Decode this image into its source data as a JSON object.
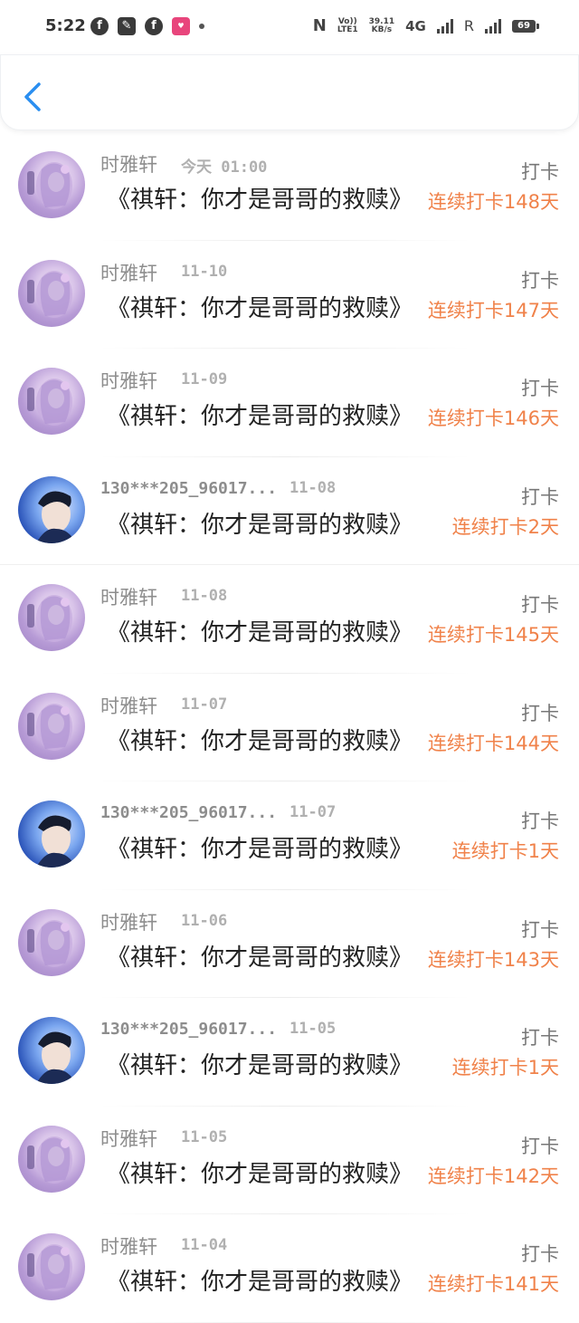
{
  "status_bar": {
    "time": "5:22",
    "net_speed_value": "39.11",
    "net_speed_unit": "KB/s",
    "volte_top": "Vo))",
    "volte_bottom": "LTE1",
    "network": "4G",
    "roaming": "R",
    "battery": "69"
  },
  "header": {
    "back_icon": "chevron-left-icon"
  },
  "entries": [
    {
      "user": "时雅轩",
      "date": "今天 01:00",
      "title": "《祺轩：你才是哥哥的救赎》",
      "action": "打卡",
      "streak": "连续打卡148天",
      "avatar": "girl"
    },
    {
      "user": "时雅轩",
      "date": "11-10",
      "title": "《祺轩：你才是哥哥的救赎》",
      "action": "打卡",
      "streak": "连续打卡147天",
      "avatar": "girl"
    },
    {
      "user": "时雅轩",
      "date": "11-09",
      "title": "《祺轩：你才是哥哥的救赎》",
      "action": "打卡",
      "streak": "连续打卡146天",
      "avatar": "girl"
    },
    {
      "user": "130***205_96017...",
      "date": "11-08",
      "title": "《祺轩：你才是哥哥的救赎》",
      "action": "打卡",
      "streak": "连续打卡2天",
      "avatar": "boy"
    },
    {
      "user": "时雅轩",
      "date": "11-08",
      "title": "《祺轩：你才是哥哥的救赎》",
      "action": "打卡",
      "streak": "连续打卡145天",
      "avatar": "girl"
    },
    {
      "user": "时雅轩",
      "date": "11-07",
      "title": "《祺轩：你才是哥哥的救赎》",
      "action": "打卡",
      "streak": "连续打卡144天",
      "avatar": "girl"
    },
    {
      "user": "130***205_96017...",
      "date": "11-07",
      "title": "《祺轩：你才是哥哥的救赎》",
      "action": "打卡",
      "streak": "连续打卡1天",
      "avatar": "boy"
    },
    {
      "user": "时雅轩",
      "date": "11-06",
      "title": "《祺轩：你才是哥哥的救赎》",
      "action": "打卡",
      "streak": "连续打卡143天",
      "avatar": "girl"
    },
    {
      "user": "130***205_96017...",
      "date": "11-05",
      "title": "《祺轩：你才是哥哥的救赎》",
      "action": "打卡",
      "streak": "连续打卡1天",
      "avatar": "boy"
    },
    {
      "user": "时雅轩",
      "date": "11-05",
      "title": "《祺轩：你才是哥哥的救赎》",
      "action": "打卡",
      "streak": "连续打卡142天",
      "avatar": "girl"
    },
    {
      "user": "时雅轩",
      "date": "11-04",
      "title": "《祺轩：你才是哥哥的救赎》",
      "action": "打卡",
      "streak": "连续打卡141天",
      "avatar": "girl"
    }
  ],
  "colors": {
    "accent_blue": "#2a8ef0",
    "streak_orange": "#f0824a",
    "muted_gray": "#8d8d8d"
  }
}
